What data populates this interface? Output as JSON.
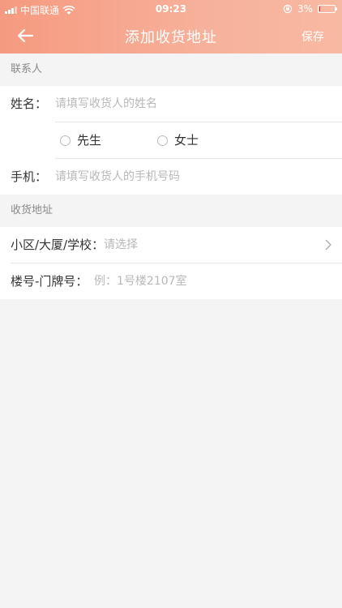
{
  "status_bar": {
    "carrier": "中国联通",
    "time": "09:23",
    "battery": "3%",
    "battery_level": 0.03
  },
  "nav": {
    "title": "添加收货地址",
    "save_label": "保存"
  },
  "contact": {
    "section_label": "联系人",
    "name_label": "姓名：",
    "name_placeholder": "请填写收货人的姓名",
    "gender_options": [
      "先生",
      "女士"
    ],
    "phone_label": "手机：",
    "phone_placeholder": "请填写收货人的手机号码"
  },
  "address": {
    "section_label": "收货地址",
    "community_label": "小区/大厦/学校：",
    "community_placeholder": "请选择",
    "room_label": "楼号-门牌号：",
    "room_placeholder": "例：1号楼2107室"
  }
}
